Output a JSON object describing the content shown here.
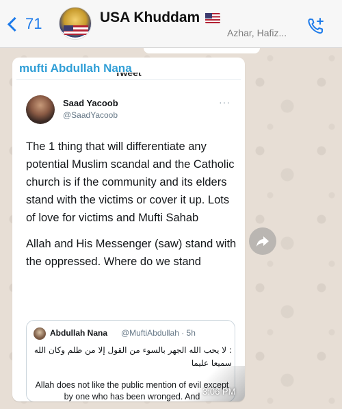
{
  "header": {
    "back_count": "71",
    "chat_title": "USA Khuddam",
    "members_preview": "Azhar, Hafiz..."
  },
  "message": {
    "sender_name": "mufti Abdullah Nana",
    "tweet_header": "Tweet",
    "timestamp": "3:06 PM"
  },
  "tweet": {
    "author_name": "Saad Yacoob",
    "author_handle": "@SaadYacoob",
    "more": "···",
    "paragraph_1": "The 1 thing that will differentiate any potential Muslim scandal and the Catholic church is if the community and its elders stand with the victims or cover it up. Lots of love for victims and Mufti Sahab",
    "paragraph_2": "Allah and His Messenger (saw) stand with the oppressed. Where do we stand"
  },
  "quoted_tweet": {
    "author_name": "Abdullah Nana",
    "meta": "@MuftiAbdullah · 5h",
    "arabic_text": ": لا يحب الله الجهر بالسوء من القول إلا من ظلم وكان الله سميعا عليما",
    "english_text": "Allah does not like the public mention of evil except by one who has been wronged. And"
  },
  "colors": {
    "accent_blue": "#1e7bea",
    "sender_blue": "#2f9ed6",
    "header_bg": "#f7f7f7",
    "wallpaper": "#e7ded5"
  },
  "icons": {
    "back": "chevron-left-icon",
    "call": "add-call-icon",
    "forward": "forward-arrow-icon"
  }
}
